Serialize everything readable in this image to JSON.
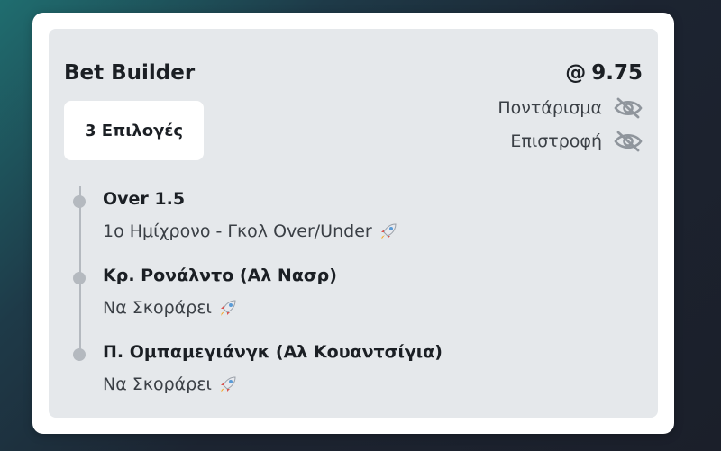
{
  "bet": {
    "title": "Bet Builder",
    "selections_label": "3 Επιλογές",
    "odds_prefix": "@",
    "odds_value": "9.75",
    "stake_label": "Ποντάρισμα",
    "return_label": "Επιστροφή",
    "legs": [
      {
        "name": "Over 1.5",
        "market": "1ο Ημίχρονο - Γκολ Over/Under"
      },
      {
        "name": "Κρ. Ρονάλντο (Αλ Νασρ)",
        "market": "Να Σκοράρει"
      },
      {
        "name": "Π. Ομπαμεγιάνγκ (Αλ Κουαντσίγια)",
        "market": "Να Σκοράρει"
      }
    ]
  },
  "icons": {
    "hidden": "eye-slash-icon",
    "boost": "rocket-icon"
  },
  "colors": {
    "card_bg": "#ffffff",
    "panel_bg": "#e5e8eb",
    "text_primary": "#1b1f24",
    "text_secondary": "#3a3f45",
    "timeline": "#b4b9bf"
  }
}
